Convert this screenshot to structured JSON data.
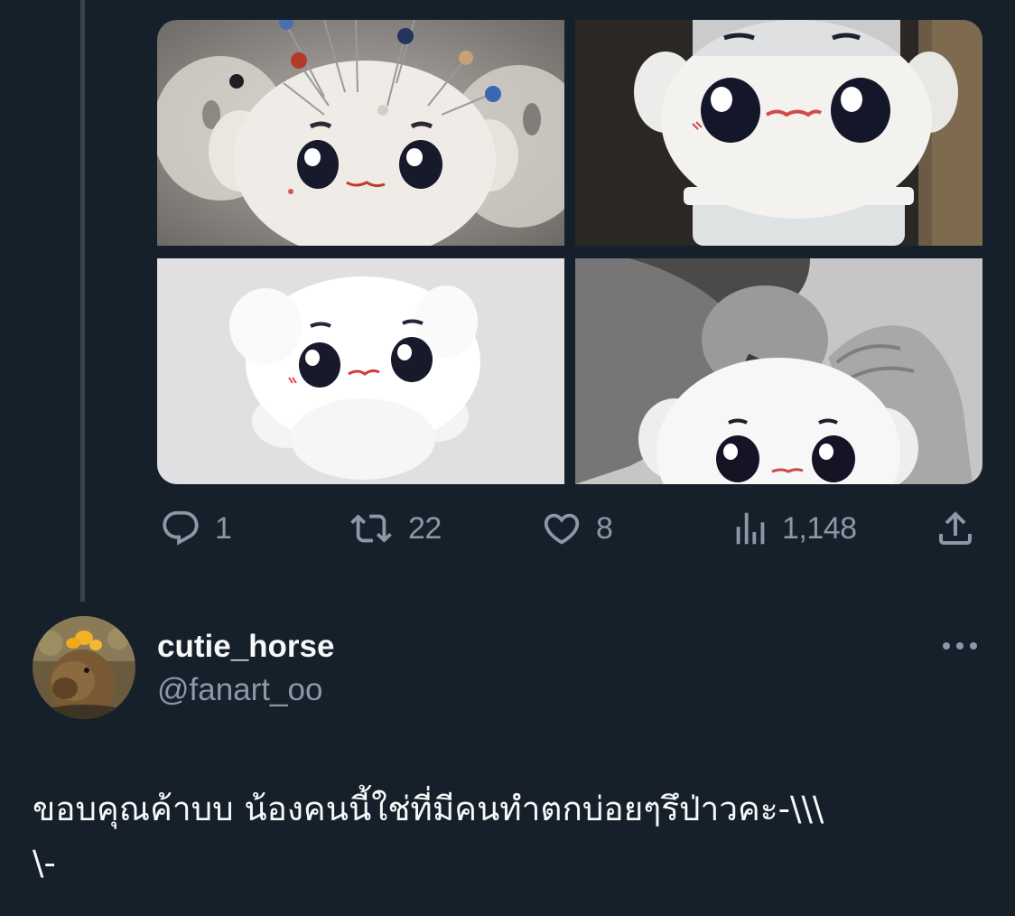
{
  "media": [
    {
      "alt": "plush with pins"
    },
    {
      "alt": "plush on jar"
    },
    {
      "alt": "fluffy white plush"
    },
    {
      "alt": "man kissing plush"
    }
  ],
  "actions": {
    "reply": {
      "icon": "reply-icon",
      "count": "1"
    },
    "retweet": {
      "icon": "retweet-icon",
      "count": "22"
    },
    "like": {
      "icon": "heart-icon",
      "count": "8"
    },
    "views": {
      "icon": "views-chart-icon",
      "count": "1,148"
    },
    "share": {
      "icon": "share-icon"
    }
  },
  "reply_tweet": {
    "display_name": "cutie_horse",
    "handle": "@fanart_oo",
    "more_icon": "more-options-icon",
    "text": "ขอบคุณค้าบบ น้องคนนี้ใช่ที่มีคนทำตกบ่อยๆรึป่าวคะ-\\\\\\\n\\-"
  },
  "colors": {
    "background": "#15202b",
    "text_primary": "#f7f9f9",
    "text_secondary": "#8b98a5",
    "thread_line": "#38444d"
  }
}
